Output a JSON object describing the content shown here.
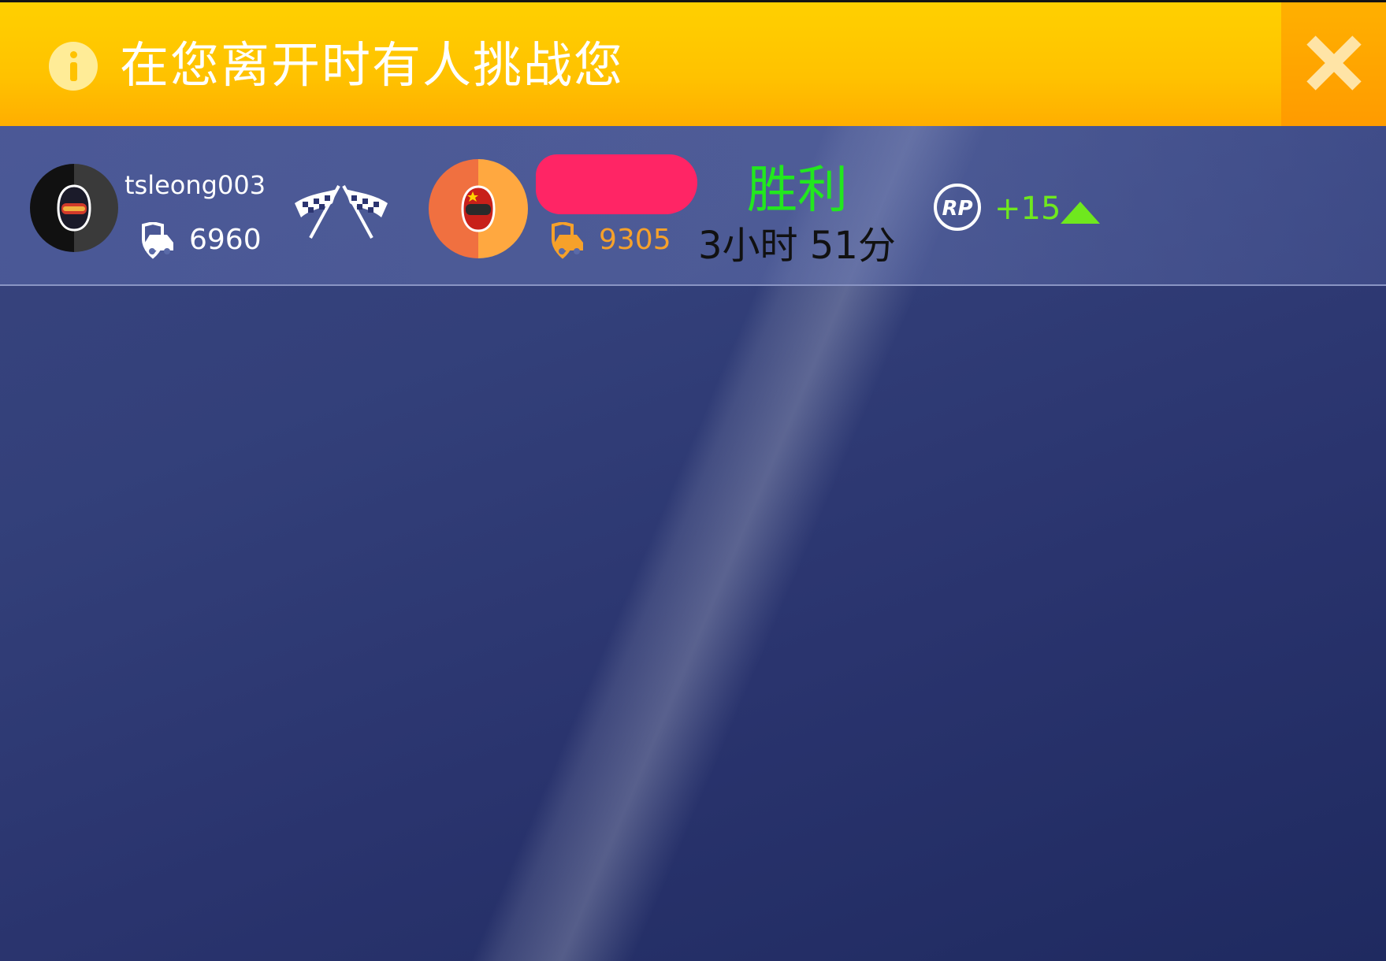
{
  "banner": {
    "title": "在您离开时有人挑战您",
    "accent_color": "#ffc200",
    "icon": "info-icon",
    "close_icon": "close-icon"
  },
  "challenge": {
    "player": {
      "name": "tsleong003",
      "rating": "6960",
      "avatar_icon": "helmet-icon"
    },
    "versus_icon": "checkered-flags-icon",
    "opponent": {
      "name_redacted": true,
      "rating": "9305",
      "rating_color": "#f6a12a",
      "avatar_icon": "helmet-icon"
    },
    "result": "胜利",
    "result_color": "#22e81e",
    "time_ago": "3小时 51分",
    "rp_icon": "rp-icon",
    "rp_change": "+15",
    "rp_change_color": "#6fe81e",
    "trend_icon": "up-arrow-icon"
  }
}
